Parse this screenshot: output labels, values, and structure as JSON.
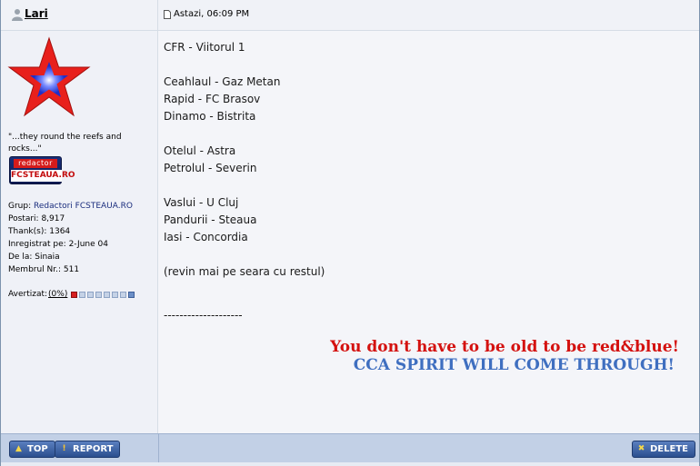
{
  "post": {
    "author": "Lari",
    "date": "Astazi, 06:09 PM",
    "body_lines": [
      "CFR - Viitorul 1",
      "",
      "Ceahlaul - Gaz Metan",
      "Rapid - FC Brasov",
      "Dinamo - Bistrita",
      "",
      "Otelul - Astra",
      "Petrolul - Severin",
      "",
      "Vaslui - U Cluj",
      "Pandurii - Steaua",
      "Iasi - Concordia",
      "",
      "(revin mai pe seara cu restul)"
    ],
    "signature_divider": "--------------------",
    "signature_line1": "You don't have to be old to be red&blue!",
    "signature_line2": "CCA SPIRIT WILL COME THROUGH!"
  },
  "author_panel": {
    "quote": "\"...they round the reefs and rocks...\"",
    "rank_badge_top": "redactor",
    "rank_badge_bottom": "FCSTEAUA.RO",
    "group_label": "Grup:",
    "group_value": "Redactori FCSTEAUA.RO",
    "posts": "Postari: 8,917",
    "thanks": "Thank(s): 1364",
    "registered": "Inregistrat pe: 2-June 04",
    "location": "De la: Sinaia",
    "member_no": "Membrul Nr.: 511",
    "warn_label": "Avertizat:",
    "warn_percent": "(0%)"
  },
  "buttons": {
    "top": "TOP",
    "report": "REPORT",
    "delete": "DELETE"
  },
  "colors": {
    "signature_red": "#d4110f",
    "signature_blue": "#3f6fc0",
    "button_blue": "#2b4f8f",
    "footer_bg": "#c2d0e6"
  },
  "icons": {
    "user": "user-icon",
    "doc": "document-icon",
    "avatar": "red-blue-star-avatar",
    "top": "arrow-up-icon",
    "report": "exclamation-icon",
    "delete": "close-x-icon"
  }
}
